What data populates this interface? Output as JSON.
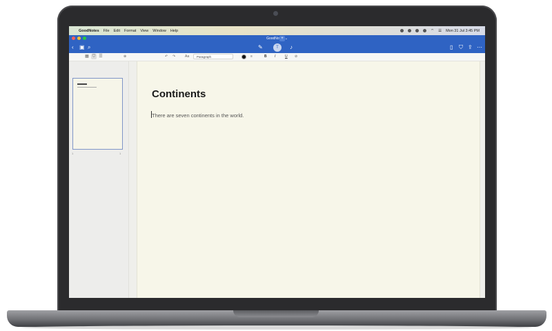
{
  "menubar": {
    "app_name": "GoodNotes",
    "items": [
      "File",
      "Edit",
      "Format",
      "View",
      "Window",
      "Help"
    ],
    "clock": "Mon 31 Jul  3:45 PM"
  },
  "titlebar": {
    "doc_name": "GoodNotes ⌄"
  },
  "formatbar": {
    "style": "Paragraph",
    "bold": "B",
    "italic": "I",
    "underline": "U"
  },
  "sidebar": {
    "page_left": "1",
    "page_right": "1"
  },
  "document": {
    "title": "Continents",
    "body": "There are seven continents in the world."
  }
}
